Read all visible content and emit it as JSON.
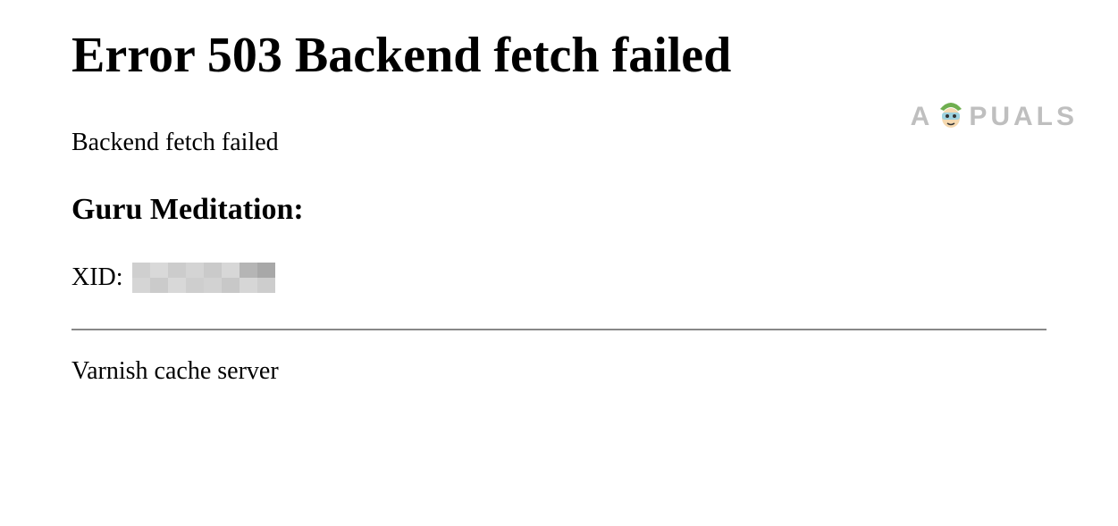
{
  "error": {
    "heading": "Error 503 Backend fetch failed",
    "message": "Backend fetch failed",
    "guru_heading": "Guru Meditation:",
    "xid_label": "XID:",
    "footer": "Varnish cache server"
  },
  "watermark": {
    "left": "A",
    "right": "PUALS"
  }
}
